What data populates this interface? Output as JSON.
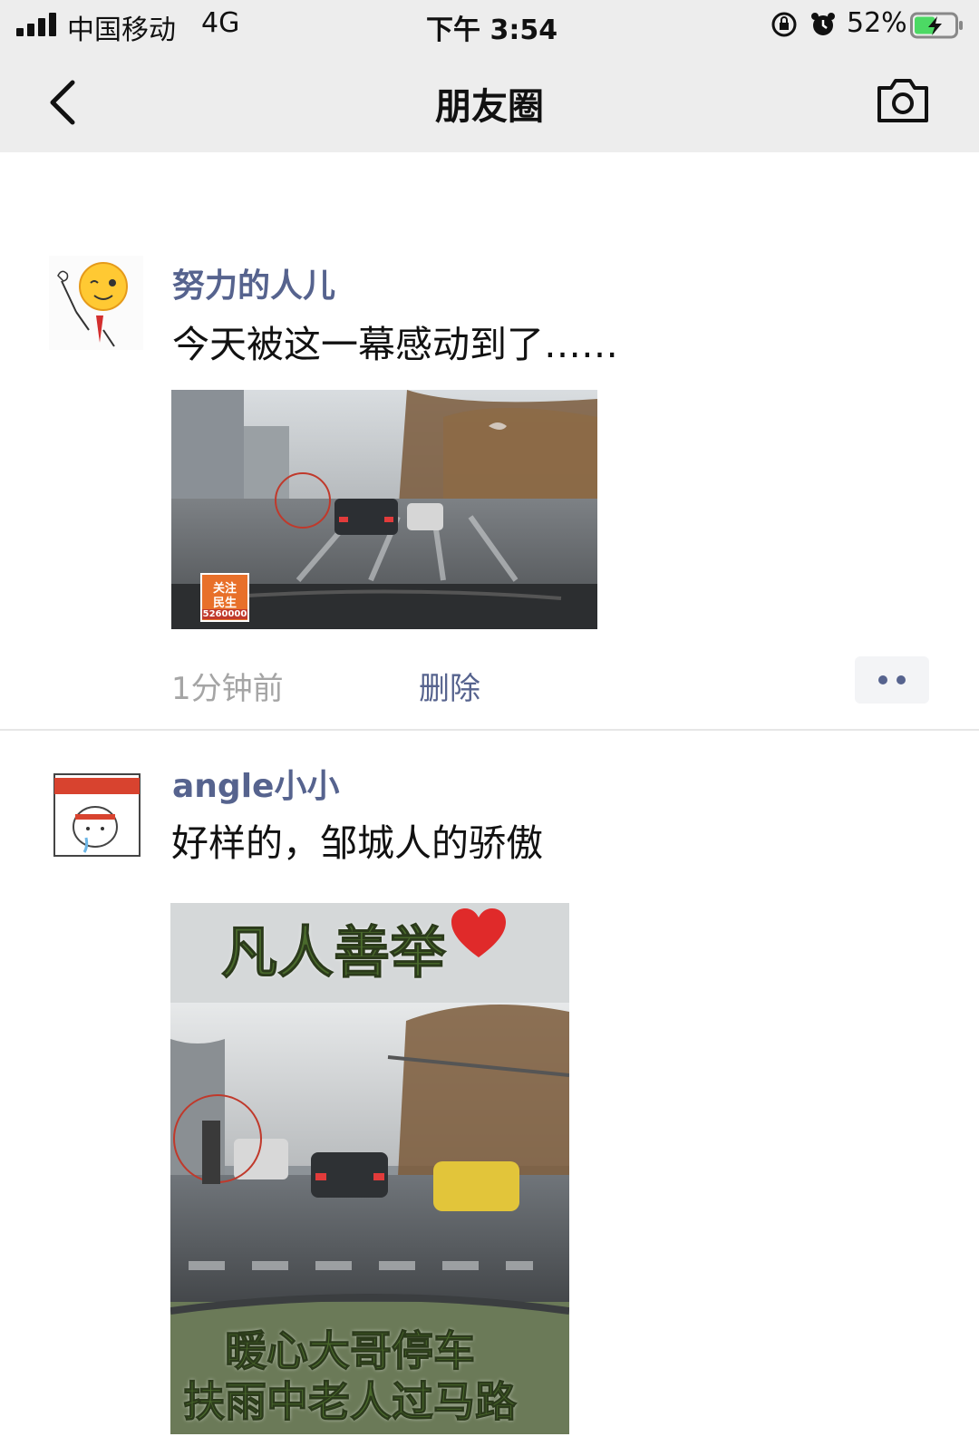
{
  "status_bar": {
    "carrier": "中国移动",
    "network": "4G",
    "time": "下午 3:54",
    "battery_percent": "52%",
    "battery_level": 0.52
  },
  "nav": {
    "title": "朋友圈"
  },
  "posts": [
    {
      "username": "努力的人儿",
      "text": "今天被这一幕感动到了……",
      "time": "1分钟前",
      "delete_label": "删除",
      "image_overlays": {
        "badge_top": "关注",
        "badge_bottom": "民生",
        "phone": "5260000"
      }
    },
    {
      "username": "angle小小",
      "text": "好样的，邹城人的骄傲",
      "image_overlays": {
        "headline": "凡人善举",
        "caption_line1": "暖心大哥停车",
        "caption_line2": "扶雨中老人过马路"
      }
    }
  ],
  "colors": {
    "username": "#56638e",
    "nav_background": "#ededed",
    "timestamp": "#a5a5a5"
  }
}
